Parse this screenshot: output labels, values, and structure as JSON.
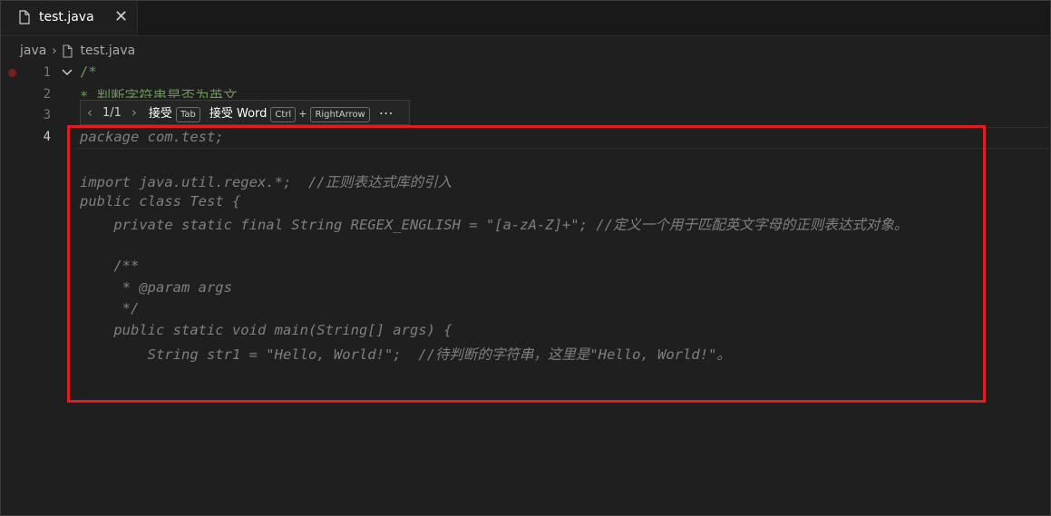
{
  "tab": {
    "label": "test.java",
    "file_icon": "file-icon",
    "close_icon": "close-icon"
  },
  "breadcrumb": {
    "folder": "java",
    "file": "test.java"
  },
  "gutter": {
    "lines": [
      "1",
      "2",
      "3",
      "4"
    ]
  },
  "code": {
    "line1": "/*",
    "line2": "* 判断字符串是否为英文"
  },
  "suggestion_widget": {
    "counter": "1/1",
    "accept_label": "接受",
    "accept_key": "Tab",
    "accept_word_label": "接受 Word",
    "accept_word_key1": "Ctrl",
    "plus": "+",
    "accept_word_key2": "RightArrow",
    "more": "⋯"
  },
  "ghost_text": [
    "package com.test;",
    "",
    "import java.util.regex.*;  //正则表达式库的引入",
    "public class Test {",
    "    private static final String REGEX_ENGLISH = \"[a-zA-Z]+\"; //定义一个用于匹配英文字母的正则表达式对象。",
    "",
    "    /**",
    "     * @param args",
    "     */",
    "    public static void main(String[] args) {",
    "        String str1 = \"Hello, World!\";  //待判断的字符串，这里是\"Hello, World!\"。"
  ],
  "colors": {
    "highlight": "#e01e22",
    "comment": "#6a9955",
    "ghost": "#7f7f7f",
    "background": "#1f1f1f"
  }
}
